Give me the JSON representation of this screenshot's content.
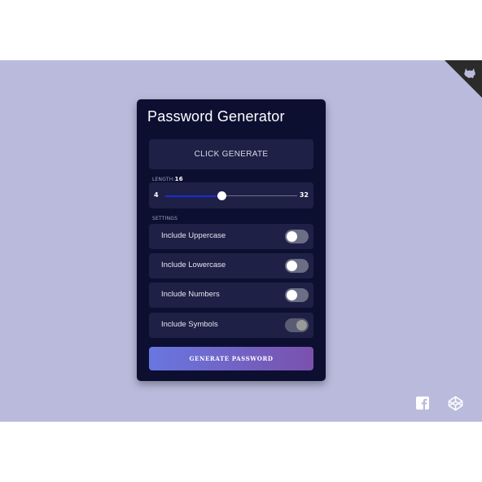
{
  "app": {
    "title": "Password Generator",
    "result_placeholder": "CLICK GENERATE"
  },
  "length": {
    "label": "LENGTH:",
    "value": "16",
    "min": "4",
    "max": "32",
    "current": 16
  },
  "settings": {
    "label": "SETTINGS",
    "items": [
      {
        "label": "Include Uppercase",
        "state": "off"
      },
      {
        "label": "Include Lowercase",
        "state": "off"
      },
      {
        "label": "Include Numbers",
        "state": "off"
      },
      {
        "label": "Include Symbols",
        "state": "on-disabled"
      }
    ]
  },
  "actions": {
    "generate_label": "GENERATE PASSWORD"
  },
  "icons": {
    "corner": "github-cat-icon",
    "social_1": "facebook-icon",
    "social_2": "codepen-icon"
  },
  "colors": {
    "background": "#babbdc",
    "card": "#0d0f31",
    "panel": "#1e2145",
    "slider_fill": "#1d2bd6",
    "button_gradient_start": "#6877e0",
    "button_gradient_end": "#7a51ad"
  }
}
